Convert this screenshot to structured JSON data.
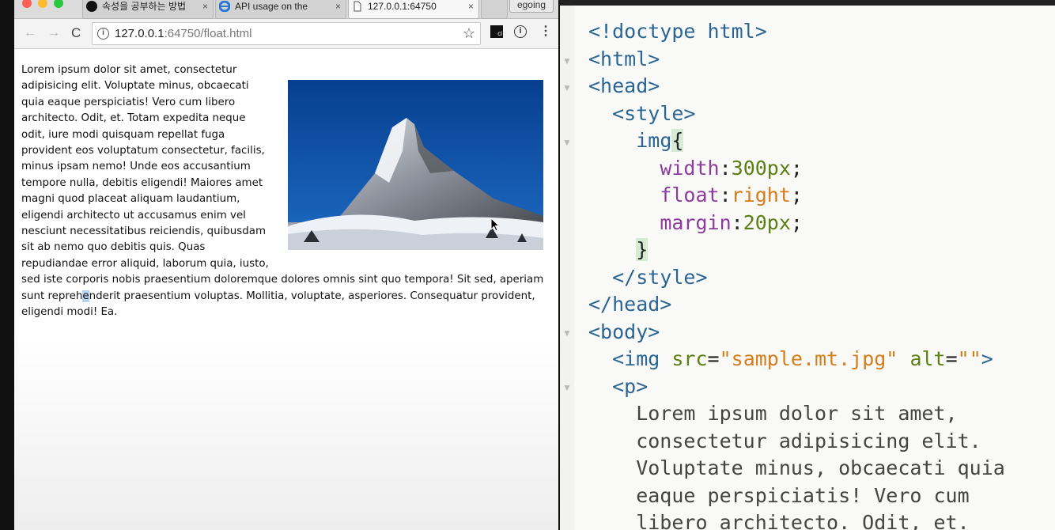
{
  "browser": {
    "tabs": [
      {
        "title": "속성을 공부하는 방법",
        "icon": "github-icon",
        "close": "×"
      },
      {
        "title": "API usage on the",
        "icon": "edge-icon",
        "close": "×"
      },
      {
        "title": "127.0.0.1:64750",
        "icon": "page-icon",
        "close": "×"
      }
    ],
    "profile": "egoing",
    "nav": {
      "back": "←",
      "forward": "→",
      "reload": "C"
    },
    "url_host": "127.0.0.1",
    "url_path": ":64750/float.html",
    "toolbar_icons": {
      "star": "☆",
      "info": "i",
      "menu": "⋮"
    }
  },
  "page": {
    "text_before_highlight": "Lorem ipsum dolor sit amet, consectetur adipisicing elit. Voluptate minus, obcaecati quia eaque perspiciatis! Vero cum libero architecto. Odit, et. Totam expedita neque odit, iure modi quisquam repellat fuga provident eos voluptatum consectetur, facilis, minus ipsam nemo! Unde eos accusantium tempore nulla, debitis eligendi! Maiores amet magni quod placeat aliquam laudantium, eligendi architecto ut accusamus enim vel nesciunt necessitatibus reiciendis, quibusdam sit ab nemo quo debitis quis. Quas repudiandae error aliquid, laborum quia, iusto, sed iste corporis nobis praesentium doloremque dolores omnis sint quo tempora! Sit sed, aperiam sunt repreh",
    "text_highlight": "e",
    "text_after_highlight": "nderit praesentium voluptas. Mollitia, voluptate, asperiores. Consequatur provident, eligendi modi! Ea.",
    "image_alt": ""
  },
  "editor": {
    "lines": [
      [
        {
          "c": "c-tag",
          "t": "<!doctype html>"
        }
      ],
      [
        {
          "c": "c-tag",
          "t": "<html>"
        }
      ],
      [
        {
          "c": "c-tag",
          "t": "<head>"
        }
      ],
      [
        {
          "c": "",
          "t": "  "
        },
        {
          "c": "c-tag",
          "t": "<style>"
        }
      ],
      [
        {
          "c": "",
          "t": "    "
        },
        {
          "c": "c-tag",
          "t": "img"
        },
        {
          "c": "c-brace",
          "t": "{"
        }
      ],
      [
        {
          "c": "",
          "t": "      "
        },
        {
          "c": "c-prop",
          "t": "width"
        },
        {
          "c": "",
          "t": ":"
        },
        {
          "c": "c-num",
          "t": "300px"
        },
        {
          "c": "",
          "t": ";"
        }
      ],
      [
        {
          "c": "",
          "t": "      "
        },
        {
          "c": "c-prop",
          "t": "float"
        },
        {
          "c": "",
          "t": ":"
        },
        {
          "c": "c-kw",
          "t": "right"
        },
        {
          "c": "",
          "t": ";"
        }
      ],
      [
        {
          "c": "",
          "t": "      "
        },
        {
          "c": "c-prop",
          "t": "margin"
        },
        {
          "c": "",
          "t": ":"
        },
        {
          "c": "c-num",
          "t": "20px"
        },
        {
          "c": "",
          "t": ";"
        }
      ],
      [
        {
          "c": "",
          "t": "    "
        },
        {
          "c": "c-brace",
          "t": "}"
        }
      ],
      [
        {
          "c": "",
          "t": "  "
        },
        {
          "c": "c-tag",
          "t": "</style>"
        }
      ],
      [
        {
          "c": "c-tag",
          "t": "</head>"
        }
      ],
      [
        {
          "c": "c-tag",
          "t": "<body>"
        }
      ],
      [
        {
          "c": "",
          "t": "  "
        },
        {
          "c": "c-tag",
          "t": "<img "
        },
        {
          "c": "c-attr",
          "t": "src"
        },
        {
          "c": "",
          "t": "="
        },
        {
          "c": "c-str",
          "t": "\"sample.mt.jpg\""
        },
        {
          "c": "",
          "t": " "
        },
        {
          "c": "c-attr",
          "t": "alt"
        },
        {
          "c": "",
          "t": "="
        },
        {
          "c": "c-str",
          "t": "\"\""
        },
        {
          "c": "c-tag",
          "t": ">"
        }
      ],
      [
        {
          "c": "",
          "t": "  "
        },
        {
          "c": "c-tag",
          "t": "<p>"
        }
      ],
      [
        {
          "c": "c-text",
          "t": "    Lorem ipsum dolor sit amet,"
        }
      ],
      [
        {
          "c": "c-text",
          "t": "    consectetur adipisicing elit."
        }
      ],
      [
        {
          "c": "c-text",
          "t": "    Voluptate minus, obcaecati quia"
        }
      ],
      [
        {
          "c": "c-text",
          "t": "    eaque perspiciatis! Vero cum"
        }
      ],
      [
        {
          "c": "c-text",
          "t": "    libero architecto. Odit, et."
        }
      ]
    ],
    "fold_markers": [
      "▼",
      "▼",
      "▼",
      "▼",
      "▼",
      "▼"
    ]
  },
  "colors": {
    "tag": "#2b6594",
    "property": "#8b3c9c",
    "number": "#5b7f12",
    "keyword": "#d37d1b",
    "selection": "#b8d2f2"
  }
}
